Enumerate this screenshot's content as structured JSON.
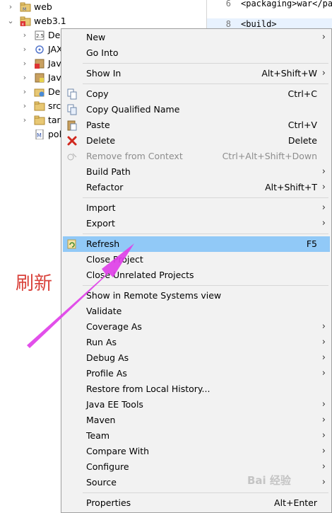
{
  "tree": {
    "items": [
      {
        "label": "web"
      },
      {
        "label": "web3.1"
      },
      {
        "label": "Dep"
      },
      {
        "label": "JAX"
      },
      {
        "label": "Jav"
      },
      {
        "label": "Jav"
      },
      {
        "label": "Dep"
      },
      {
        "label": "src"
      },
      {
        "label": "targ"
      },
      {
        "label": "pol"
      }
    ]
  },
  "editor": {
    "lines": [
      {
        "num": "6",
        "text": "<packaging>war</pac"
      },
      {
        "num": "8",
        "text": "<build>"
      }
    ]
  },
  "menu": {
    "items": [
      {
        "label": "New",
        "accel": "",
        "submenu": true
      },
      {
        "label": "Go Into",
        "accel": "",
        "submenu": false
      },
      {
        "label": "Show In",
        "accel": "Alt+Shift+W",
        "submenu": true
      },
      {
        "label": "Copy",
        "accel": "Ctrl+C",
        "submenu": false
      },
      {
        "label": "Copy Qualified Name",
        "accel": "",
        "submenu": false
      },
      {
        "label": "Paste",
        "accel": "Ctrl+V",
        "submenu": false
      },
      {
        "label": "Delete",
        "accel": "Delete",
        "submenu": false
      },
      {
        "label": "Remove from Context",
        "accel": "Ctrl+Alt+Shift+Down",
        "submenu": false,
        "disabled": true
      },
      {
        "label": "Build Path",
        "accel": "",
        "submenu": true
      },
      {
        "label": "Refactor",
        "accel": "Alt+Shift+T",
        "submenu": true
      },
      {
        "label": "Import",
        "accel": "",
        "submenu": true
      },
      {
        "label": "Export",
        "accel": "",
        "submenu": true
      },
      {
        "label": "Refresh",
        "accel": "F5",
        "submenu": false,
        "highlighted": true
      },
      {
        "label": "Close Project",
        "accel": "",
        "submenu": false
      },
      {
        "label": "Close Unrelated Projects",
        "accel": "",
        "submenu": false
      },
      {
        "label": "Show in Remote Systems view",
        "accel": "",
        "submenu": false
      },
      {
        "label": "Validate",
        "accel": "",
        "submenu": false
      },
      {
        "label": "Coverage As",
        "accel": "",
        "submenu": true
      },
      {
        "label": "Run As",
        "accel": "",
        "submenu": true
      },
      {
        "label": "Debug As",
        "accel": "",
        "submenu": true
      },
      {
        "label": "Profile As",
        "accel": "",
        "submenu": true
      },
      {
        "label": "Restore from Local History...",
        "accel": "",
        "submenu": false
      },
      {
        "label": "Java EE Tools",
        "accel": "",
        "submenu": true
      },
      {
        "label": "Maven",
        "accel": "",
        "submenu": true
      },
      {
        "label": "Team",
        "accel": "",
        "submenu": true
      },
      {
        "label": "Compare With",
        "accel": "",
        "submenu": true
      },
      {
        "label": "Configure",
        "accel": "",
        "submenu": true
      },
      {
        "label": "Source",
        "accel": "",
        "submenu": true
      },
      {
        "label": "Properties",
        "accel": "Alt+Enter",
        "submenu": false
      }
    ],
    "arrow_glyph": "›"
  },
  "annotation": {
    "text": "刷新",
    "color": "#d9413a",
    "arrow_color": "#e040e8"
  },
  "watermark": {
    "text": "Bai 经验"
  },
  "colors": {
    "highlight": "#91c9f7",
    "menu_bg": "#f2f2f2",
    "disabled": "#8d8d8d"
  }
}
